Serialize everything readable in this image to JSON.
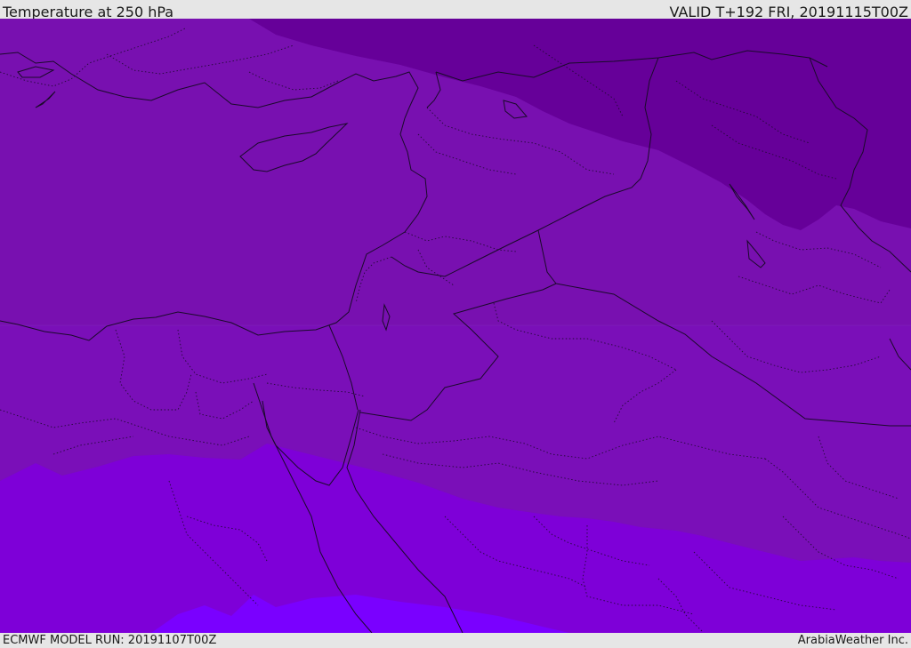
{
  "header": {
    "title": "Temperature at 250 hPa",
    "valid_time": "VALID T+192 FRI, 20191115T00Z"
  },
  "footer": {
    "model_run": "ECMWF MODEL RUN: 20191107T00Z",
    "credit": "ArabiaWeather Inc."
  },
  "map": {
    "field_colors": {
      "coldest_band": "#660099",
      "cold_band": "#7810b0",
      "middle_band": "#7a0fb8",
      "warm_band": "#7e00d8",
      "warmest_band": "#7a00ff"
    },
    "coastline_color": "#1a0a2a",
    "border_color": "#1a0a2a"
  }
}
